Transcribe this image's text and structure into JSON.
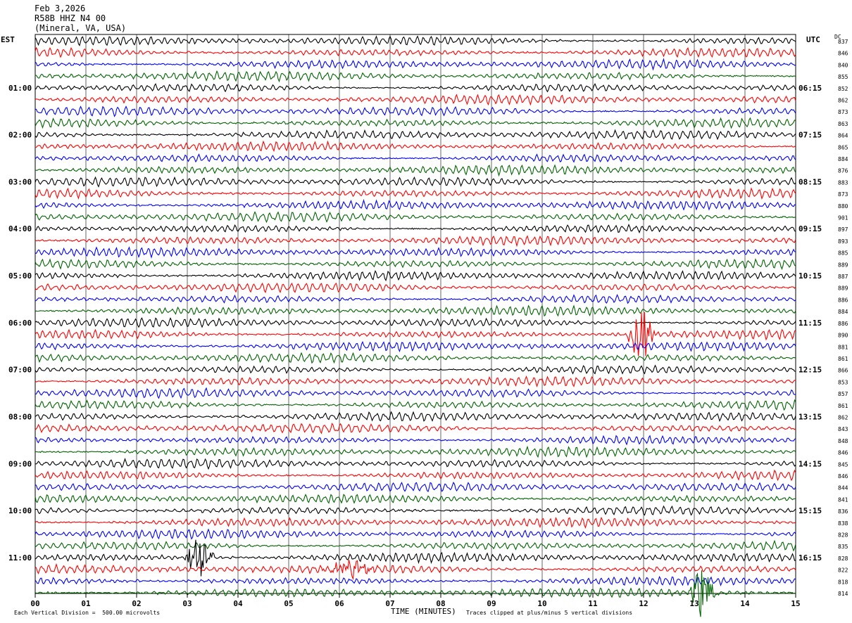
{
  "header": {
    "date": "Feb 3,2026",
    "station": "R58B HHZ N4 00",
    "location": "(Mineral, VA, USA)"
  },
  "left_axis_label": "EST",
  "right_axis_label": "UTC",
  "dc_label": "DC",
  "footer": {
    "scale_note": "Each Vertical Division =  500.00 microvolts",
    "xlabel": "TIME (MINUTES)",
    "clip_note": "Traces clipped at plus/minus 5 vertical divisions"
  },
  "colors": [
    "#000000",
    "#ff0000",
    "#0000ff",
    "#006400"
  ],
  "chart_data": {
    "type": "line",
    "xlabel": "TIME (MINUTES)",
    "xlim": [
      0,
      15
    ],
    "x_ticks": [
      "00",
      "01",
      "02",
      "03",
      "04",
      "05",
      "06",
      "07",
      "08",
      "09",
      "10",
      "11",
      "12",
      "13",
      "14",
      "15"
    ],
    "rows_per_hour": 4,
    "left_hour_labels": [
      "01:00",
      "02:00",
      "03:00",
      "04:00",
      "05:00",
      "06:00",
      "07:00",
      "08:00",
      "09:00",
      "10:00",
      "11:00"
    ],
    "right_hour_labels": [
      "06:15",
      "07:15",
      "08:15",
      "09:15",
      "10:15",
      "11:15",
      "12:15",
      "13:15",
      "14:15",
      "15:15",
      "16:15"
    ],
    "dc_offsets": [
      "837",
      "846",
      "840",
      "855",
      "852",
      "862",
      "873",
      "863",
      "864",
      "865",
      "884",
      "876",
      "883",
      "873",
      "880",
      "901",
      "897",
      "893",
      "885",
      "889",
      "887",
      "889",
      "886",
      "884",
      "886",
      "890",
      "881",
      "861",
      "866",
      "853",
      "857",
      "861",
      "862",
      "843",
      "848",
      "846",
      "845",
      "846",
      "844",
      "841",
      "836",
      "838",
      "828",
      "835",
      "828",
      "822",
      "818",
      "814"
    ],
    "events": [
      {
        "row": 25,
        "minute": 11.95,
        "amplitude": "clipped"
      },
      {
        "row": 44,
        "minute": 3.25,
        "amplitude": "clipped"
      },
      {
        "row": 45,
        "minute": 6.2,
        "amplitude": "moderate"
      },
      {
        "row": 47,
        "minute": 13.15,
        "amplitude": "clipped"
      }
    ]
  }
}
